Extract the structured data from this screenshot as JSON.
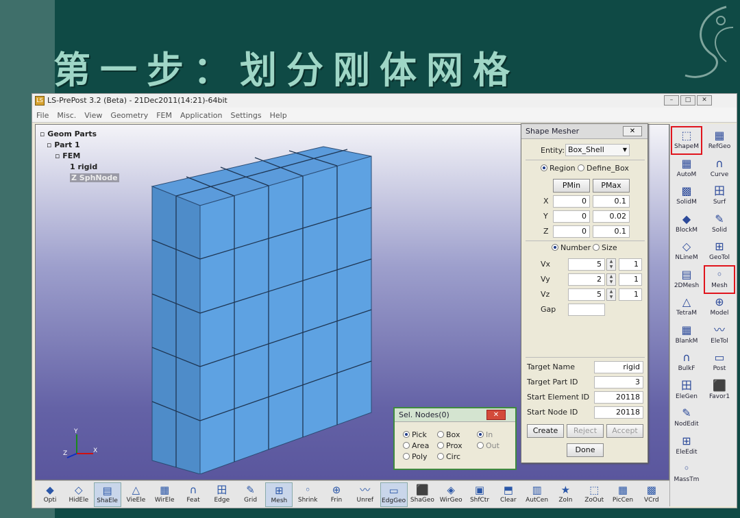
{
  "slide": {
    "title": "第一步：划分刚体网格"
  },
  "window": {
    "title": "LS-PrePost 3.2 (Beta) - 21Dec2011(14:21)-64bit"
  },
  "menu": [
    "File",
    "Misc.",
    "View",
    "Geometry",
    "FEM",
    "Application",
    "Settings",
    "Help"
  ],
  "tree": {
    "root": "Geom Parts",
    "part": "Part 1",
    "fem": "FEM",
    "rigid": "1 rigid",
    "sph": "Z SphNode"
  },
  "right_tools": {
    "left": [
      "ShapeM",
      "AutoM",
      "SolidM",
      "BlockM",
      "NLineM",
      "2DMesh",
      "TetraM",
      "BlankM",
      "BulkF",
      "EleGen",
      "NodEdit",
      "EleEdit",
      "MassTm"
    ],
    "right": [
      "RefGeo",
      "Curve",
      "Surf",
      "Solid",
      "GeoTol",
      "Mesh",
      "Model",
      "EleTol",
      "Post",
      "Favor1"
    ]
  },
  "bottom_tools": [
    "Opti",
    "HidEle",
    "ShaEle",
    "VieEle",
    "WirEle",
    "Feat",
    "Edge",
    "Grid",
    "Mesh",
    "Shrink",
    "Frin",
    "Unref",
    "EdgGeo",
    "ShaGeo",
    "WirGeo",
    "ShfCtr",
    "Clear",
    "AutCen",
    "ZoIn",
    "ZoOut",
    "PicCen",
    "VCrd"
  ],
  "shape_mesher": {
    "title": "Shape Mesher",
    "entity_label": "Entity:",
    "entity_value": "Box_Shell",
    "region": "Region",
    "define_box": "Define_Box",
    "pmin": "PMin",
    "pmax": "PMax",
    "x": {
      "label": "X",
      "min": "0",
      "max": "0.1"
    },
    "y": {
      "label": "Y",
      "min": "0",
      "max": "0.02"
    },
    "z": {
      "label": "Z",
      "min": "0",
      "max": "0.1"
    },
    "number": "Number",
    "size": "Size",
    "vx": {
      "label": "Vx",
      "val": "5",
      "r": "1"
    },
    "vy": {
      "label": "Vy",
      "val": "2",
      "r": "1"
    },
    "vz": {
      "label": "Vz",
      "val": "5",
      "r": "1"
    },
    "gap": "Gap",
    "target_name": {
      "label": "Target Name",
      "value": "rigid"
    },
    "target_part": {
      "label": "Target Part ID",
      "value": "3"
    },
    "start_elem": {
      "label": "Start Element ID",
      "value": "20118"
    },
    "start_node": {
      "label": "Start Node ID",
      "value": "20118"
    },
    "create": "Create",
    "reject": "Reject",
    "accept": "Accept",
    "done": "Done"
  },
  "sel_nodes": {
    "title": "Sel. Nodes(0)",
    "pick": "Pick",
    "box": "Box",
    "in": "In",
    "area": "Area",
    "prox": "Prox",
    "out": "Out",
    "poly": "Poly",
    "circ": "Circ"
  },
  "axis": {
    "x": "X",
    "y": "Y",
    "z": "Z"
  }
}
